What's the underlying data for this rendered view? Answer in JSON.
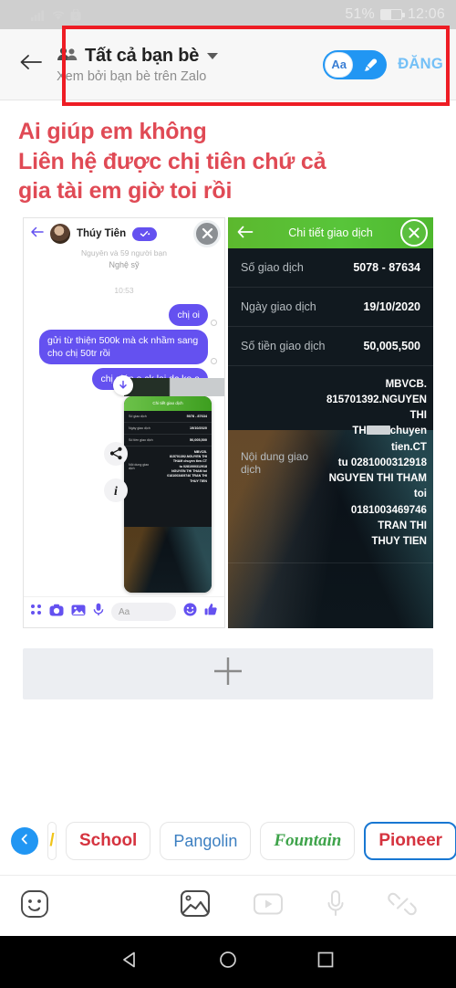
{
  "status_bar": {
    "signal_icon": "signal-bars-icon",
    "wifi_icon": "wifi-icon",
    "app_icon": "shopping-bag-icon",
    "battery_percent": "51%",
    "battery_icon": "battery-half-icon",
    "time": "12:06"
  },
  "header": {
    "back_icon": "back-arrow-icon",
    "audience_icon": "friends-group-icon",
    "audience": "Tất cả bạn bè",
    "caret_icon": "chevron-down-icon",
    "subtitle": "Xem bởi bạn bè trên Zalo",
    "toggle": {
      "text_option": "Aa",
      "brush_icon": "paint-brush-icon"
    },
    "post_label": "ĐĂNG",
    "highlight_color": "#ee1c24"
  },
  "post": {
    "lines": [
      "Ai giúp em không",
      "Liên hệ được chị tiên chứ cả",
      "gia tài em giờ toi rồi"
    ],
    "text_color": "#e04a55"
  },
  "media": {
    "chat_screenshot": {
      "back_icon": "back-arrow-icon",
      "avatar": "contact-avatar",
      "contact_name": "Thúy Tiên",
      "verified_badge_icon": "check-badge-icon",
      "close_icon": "close-x-icon",
      "mutual_friends": "Nguyễn và 59 người bạn",
      "occupation": "Nghệ sỹ",
      "timestamp": "10:53",
      "messages": [
        "chị oi",
        "gửi từ thiện 500k mà ck nhầm sang cho chị 50tr rồi",
        "chị giúp e ck lại dc ko ạ"
      ],
      "share_icon": "share-icon",
      "info_icon": "info-italic-icon",
      "download_icon": "download-arrow-icon",
      "toolbar": {
        "apps_icon": "four-dots-icon",
        "camera_icon": "camera-icon",
        "gallery_icon": "gallery-icon",
        "mic_icon": "microphone-icon",
        "input_placeholder": "Aa",
        "emoji_icon": "smiley-icon",
        "like_icon": "thumbs-up-icon"
      },
      "inner_screenshot": {
        "title": "Chi tiết giao dịch",
        "rows": [
          {
            "label": "Số giao dịch",
            "value": "5078 - 87634"
          },
          {
            "label": "Ngày giao dịch",
            "value": "19/10/2020"
          },
          {
            "label": "Số tiền giao dịch",
            "value": "50,005,500"
          }
        ],
        "content_label": "Nội dung giao dịch",
        "content_lines": [
          "MBVCB.",
          "815701392.NGUYEN THI",
          "THAM chuyen tien.CT",
          "tu 0281000312918",
          "NGUYEN THI THAM toi",
          "0181003469746 TRAN THI",
          "THUY TIEN"
        ]
      }
    },
    "transaction_screenshot": {
      "back_icon": "back-arrow-icon",
      "title": "Chi tiết giao dịch",
      "close_icon": "close-x-icon",
      "rows": [
        {
          "label": "Số giao dịch",
          "value": "5078 - 87634"
        },
        {
          "label": "Ngày giao dịch",
          "value": "19/10/2020"
        },
        {
          "label": "Số tiền giao dịch",
          "value": "50,005,500"
        }
      ],
      "content_label": "Nội dung giao dịch",
      "content_lines_pre": [
        "MBVCB.",
        "815701392.NGUYEN THI",
        "TH"
      ],
      "content_lines_post": [
        "chuyen tien.CT",
        "tu 0281000312918",
        "NGUYEN THI THAM toi",
        "0181003469746 TRAN THI",
        "THUY TIEN"
      ]
    }
  },
  "add_media": {
    "plus_icon": "plus-icon"
  },
  "font_carousel": {
    "prev_icon": "chevron-left-icon",
    "chips": [
      {
        "label": "/",
        "style": "cut"
      },
      {
        "label": "School",
        "style": "c-school"
      },
      {
        "label": "Pangolin",
        "style": "c-pangolin"
      },
      {
        "label": "Fountain",
        "style": "c-fountain"
      },
      {
        "label": "Pioneer",
        "style": "c-pioneer",
        "selected": true
      }
    ]
  },
  "bottom_toolbar": {
    "sticker_icon": "sticker-smiley-icon",
    "photo_icon": "photo-icon",
    "video_icon": "video-play-icon",
    "mic_icon": "microphone-icon",
    "link_icon": "link-chain-icon"
  },
  "nav_bar": {
    "back_icon": "nav-back-triangle-icon",
    "home_icon": "nav-home-circle-icon",
    "recents_icon": "nav-recents-square-icon"
  }
}
